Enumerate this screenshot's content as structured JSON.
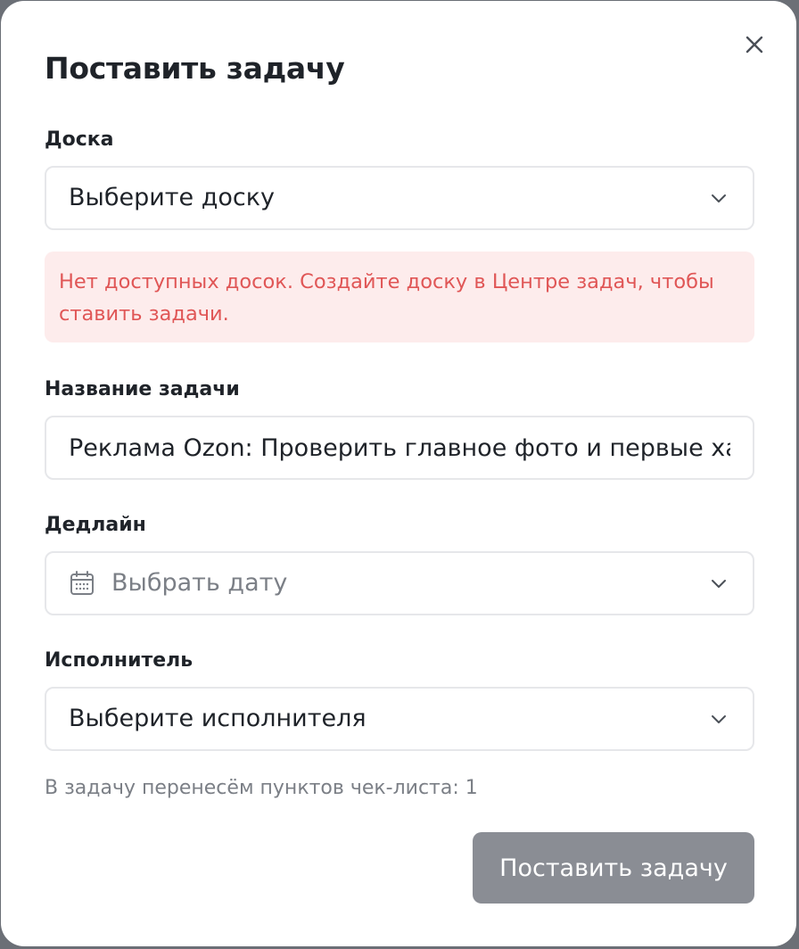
{
  "modal": {
    "title": "Поставить задачу",
    "close_icon": "close-icon"
  },
  "board": {
    "label": "Доска",
    "value": "Выберите доску",
    "icon": "chevron-down-icon"
  },
  "error": {
    "text": "Нет доступных досок. Создайте доску в Центре задач, чтобы ставить задачи.",
    "color": "#e05656",
    "background": "#fdecec"
  },
  "task_name": {
    "label": "Название задачи",
    "value": "Реклама Ozon: Проверить главное фото и первые хар"
  },
  "deadline": {
    "label": "Дедлайн",
    "placeholder": "Выбрать дату",
    "icon": "calendar-icon"
  },
  "assignee": {
    "label": "Исполнитель",
    "value": "Выберите исполнителя",
    "icon": "chevron-down-icon"
  },
  "hint": "В задачу перенесём пунктов чек-листа: 1",
  "submit": {
    "label": "Поставить задачу",
    "background": "#8a8d94"
  }
}
